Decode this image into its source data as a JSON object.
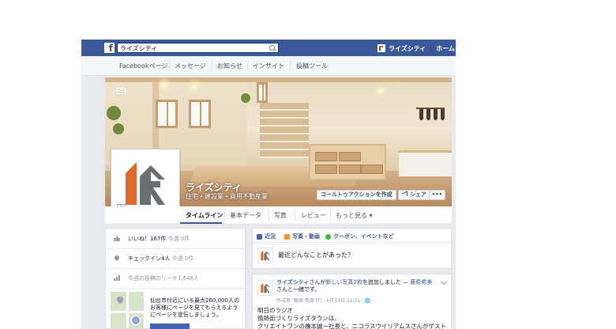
{
  "topbar": {
    "search_value": "ライズシティ",
    "page_name": "ライズシティ",
    "home_label": "ホーム",
    "colors": {
      "brand": "#3b5998"
    }
  },
  "admin_nav": {
    "items": [
      "Facebookページ",
      "メッセージ",
      "お知らせ",
      "インサイト",
      "投稿ツール"
    ]
  },
  "cover": {
    "page_title": "ライズシティ",
    "page_category": "住宅・建設業・商用不動産業",
    "cta_button": "コールトゥアクションを作成",
    "share_button": "シェア",
    "more_button": "•••"
  },
  "tabs": {
    "items": [
      "タイムライン",
      "基本データ",
      "写真",
      "レビュー",
      "もっと見る ▾"
    ],
    "active": "タイムライン"
  },
  "sidebar": {
    "likes": {
      "label": "いいね！167件",
      "sub": "今週 0件"
    },
    "checkins": {
      "label": "チェックイン4人",
      "sub": "今週 0件"
    },
    "reach": {
      "label": "今週の投稿のリーチ1,646人"
    },
    "promo_text": "仙台市付近にいる最大260,000人のお客様にページを見てもらえるようにページを宣伝しましょう。"
  },
  "composer": {
    "tabs": [
      "近況",
      "写真・動画",
      "クーポン、イベントなど"
    ],
    "placeholder": "最近どんなことがあった？"
  },
  "post": {
    "author": "ライズシティ",
    "action_mid": "さんが",
    "action_link": "新しい写真2枚",
    "action_tail": "を追加しました — ",
    "with_person": "藤原希美",
    "with_tail": "さんと一緒です。",
    "meta": "作成者: 藤原 希美 [?] · 6月13日 21:31 · 🌐",
    "body_lines": [
      "明日のラジオ",
      "情熱街づくりライズタウンは、",
      "クリエイトワンの橋本誠一社長と、ニコラスウイリアムスさんがゲストで"
    ]
  }
}
